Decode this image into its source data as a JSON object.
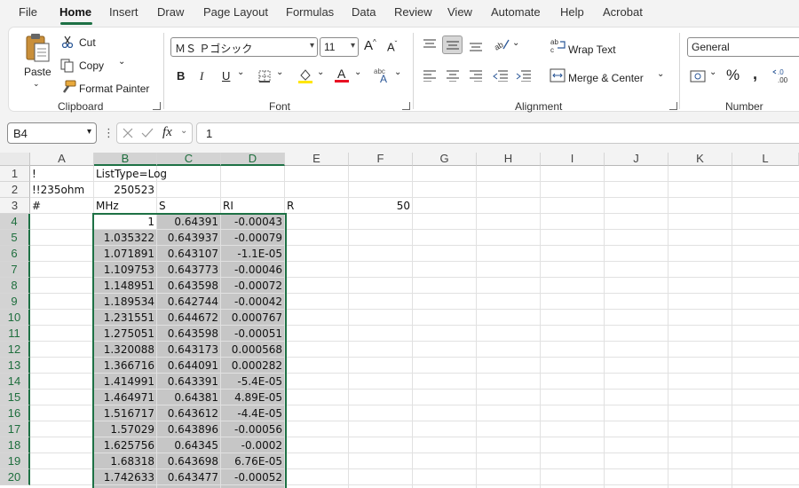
{
  "menu": {
    "tabs": [
      "File",
      "Home",
      "Insert",
      "Draw",
      "Page Layout",
      "Formulas",
      "Data",
      "Review",
      "View",
      "Automate",
      "Help",
      "Acrobat"
    ],
    "active": "Home"
  },
  "ribbon": {
    "clipboard": {
      "paste": "Paste",
      "cut": "Cut",
      "copy": "Copy",
      "format_painter": "Format Painter",
      "label": "Clipboard"
    },
    "font": {
      "name": "ＭＳ Ｐゴシック",
      "size": "11",
      "bold": "B",
      "italic": "I",
      "underline": "U",
      "label": "Font"
    },
    "alignment": {
      "wrap_text": "Wrap Text",
      "merge_center": "Merge & Center",
      "label": "Alignment"
    },
    "number": {
      "format": "General",
      "label": "Number"
    }
  },
  "formula_bar": {
    "name_box": "B4",
    "fx": "fx",
    "formula": "1"
  },
  "columns": [
    "A",
    "B",
    "C",
    "D",
    "E",
    "F",
    "G",
    "H",
    "I",
    "J",
    "K",
    "L"
  ],
  "rows": [
    "1",
    "2",
    "3",
    "4",
    "5",
    "6",
    "7",
    "8",
    "9",
    "10",
    "11",
    "12",
    "13",
    "14",
    "15",
    "16",
    "17",
    "18",
    "19",
    "20"
  ],
  "selection": {
    "active_cell": "B4",
    "columns": [
      "B",
      "C",
      "D"
    ],
    "rows_from": "4",
    "rows_to": "20"
  },
  "cells": {
    "A1": "!",
    "B1": "ListType=Log",
    "A2": "!!235ohm",
    "B2": "250523",
    "A3": "#",
    "B3": "MHz",
    "C3": "S",
    "D3": "RI",
    "E3": "R",
    "F3": "50",
    "data": [
      [
        "1",
        "0.64391",
        "-0.00043"
      ],
      [
        "1.035322",
        "0.643937",
        "-0.00079"
      ],
      [
        "1.071891",
        "0.643107",
        "-1.1E-05"
      ],
      [
        "1.109753",
        "0.643773",
        "-0.00046"
      ],
      [
        "1.148951",
        "0.643598",
        "-0.00072"
      ],
      [
        "1.189534",
        "0.642744",
        "-0.00042"
      ],
      [
        "1.231551",
        "0.644672",
        "0.000767"
      ],
      [
        "1.275051",
        "0.643598",
        "-0.00051"
      ],
      [
        "1.320088",
        "0.643173",
        "0.000568"
      ],
      [
        "1.366716",
        "0.644091",
        "0.000282"
      ],
      [
        "1.414991",
        "0.643391",
        "-5.4E-05"
      ],
      [
        "1.464971",
        "0.64381",
        "4.89E-05"
      ],
      [
        "1.516717",
        "0.643612",
        "-4.4E-05"
      ],
      [
        "1.57029",
        "0.643896",
        "-0.00056"
      ],
      [
        "1.625756",
        "0.64345",
        "-0.0002"
      ],
      [
        "1.68318",
        "0.643698",
        "6.76E-05"
      ],
      [
        "1.742633",
        "0.643477",
        "-0.00052"
      ]
    ]
  },
  "colors": {
    "accent": "#1e7145",
    "selection_fill": "#c6c6c6",
    "ribbon_bg": "#f3f3f3"
  }
}
